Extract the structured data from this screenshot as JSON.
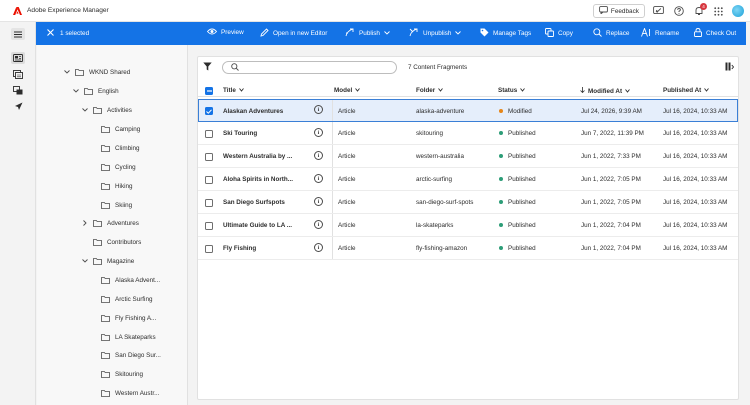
{
  "app": {
    "title": "Adobe Experience Manager"
  },
  "header": {
    "feedback_label": "Feedback",
    "notification_count": "4"
  },
  "action_bar": {
    "selected_label": "1 selected",
    "actions": [
      {
        "label": "Preview"
      },
      {
        "label": "Open in new Editor"
      },
      {
        "label": "Publish"
      },
      {
        "label": "Unpublish"
      },
      {
        "label": "Manage Tags"
      },
      {
        "label": "Copy"
      },
      {
        "label": "Replace"
      },
      {
        "label": "Rename"
      },
      {
        "label": "Check Out"
      }
    ]
  },
  "tree": {
    "nodes": [
      {
        "label": "WKND Shared"
      },
      {
        "label": "English"
      },
      {
        "label": "Activities"
      },
      {
        "label": "Camping"
      },
      {
        "label": "Climbing"
      },
      {
        "label": "Cycling"
      },
      {
        "label": "Hiking"
      },
      {
        "label": "Skiing"
      },
      {
        "label": "Adventures"
      },
      {
        "label": "Contributors"
      },
      {
        "label": "Magazine"
      },
      {
        "label": "Alaska Advent..."
      },
      {
        "label": "Arctic Surfing"
      },
      {
        "label": "Fly Fishing A..."
      },
      {
        "label": "LA Skateparks"
      },
      {
        "label": "San Diego Sur..."
      },
      {
        "label": "Skitouring"
      },
      {
        "label": "Western Austr..."
      }
    ]
  },
  "content": {
    "search_placeholder": "",
    "count_label": "7 Content Fragments",
    "columns": {
      "title": "Title",
      "model": "Model",
      "folder": "Folder",
      "status": "Status",
      "modified": "Modified At",
      "published": "Published At"
    },
    "rows": [
      {
        "title": "Alaskan Adventures",
        "model": "Article",
        "folder": "alaska-adventure",
        "status": "Modified",
        "modified": "Jul 24, 2026, 9:39 AM",
        "published": "Jul 16, 2024, 10:33 AM"
      },
      {
        "title": "Ski Touring",
        "model": "Article",
        "folder": "skitouring",
        "status": "Published",
        "modified": "Jun 7, 2022, 11:39 PM",
        "published": "Jul 16, 2024, 10:33 AM"
      },
      {
        "title": "Western Australia by ...",
        "model": "Article",
        "folder": "western-australia",
        "status": "Published",
        "modified": "Jun 1, 2022, 7:33 PM",
        "published": "Jul 16, 2024, 10:33 AM"
      },
      {
        "title": "Aloha Spirits in North...",
        "model": "Article",
        "folder": "arctic-surfing",
        "status": "Published",
        "modified": "Jun 1, 2022, 7:05 PM",
        "published": "Jul 16, 2024, 10:33 AM"
      },
      {
        "title": "San Diego Surfspots",
        "model": "Article",
        "folder": "san-diego-surf-spots",
        "status": "Published",
        "modified": "Jun 1, 2022, 7:05 PM",
        "published": "Jul 16, 2024, 10:33 AM"
      },
      {
        "title": "Ultimate Guide to LA ...",
        "model": "Article",
        "folder": "la-skateparks",
        "status": "Published",
        "modified": "Jun 1, 2022, 7:04 PM",
        "published": "Jul 16, 2024, 10:33 AM"
      },
      {
        "title": "Fly Fishing",
        "model": "Article",
        "folder": "fly-fishing-amazon",
        "status": "Published",
        "modified": "Jun 1, 2022, 7:04 PM",
        "published": "Jul 16, 2024, 10:33 AM"
      }
    ]
  },
  "colors": {
    "accent": "#1473e6",
    "status_modified": "#e68619",
    "status_published": "#2d9d78",
    "selected_row": "#e5eefb"
  },
  "icons": [
    "adobe-logo-icon",
    "feedback-icon",
    "chat-icon",
    "help-icon",
    "bell-icon",
    "apps-grid-icon",
    "menu-icon",
    "content-icon",
    "assets-icon",
    "sites-icon",
    "launch-icon",
    "close-icon",
    "eye-icon",
    "pencil-icon",
    "publish-icon",
    "unpublish-icon",
    "tag-icon",
    "copy-icon",
    "replace-icon",
    "rename-icon",
    "lock-icon",
    "filter-icon",
    "search-icon",
    "column-settings-icon",
    "folder-icon",
    "chevron-icon",
    "info-icon",
    "sort-arrow-icon"
  ]
}
